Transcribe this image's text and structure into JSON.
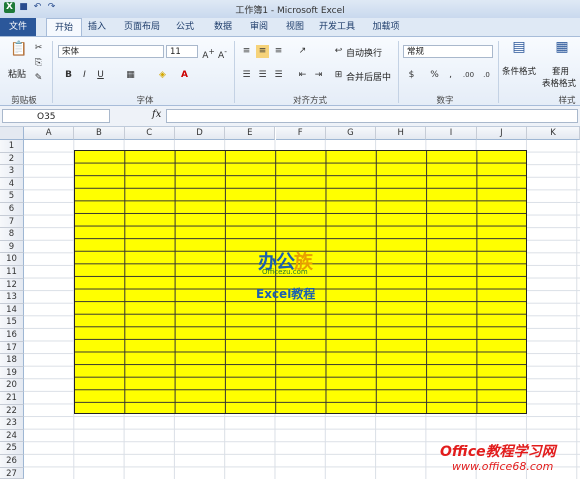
{
  "window": {
    "title": "工作簿1 - Microsoft Excel"
  },
  "tabs": [
    "文件",
    "开始",
    "插入",
    "页面布局",
    "公式",
    "数据",
    "审阅",
    "视图",
    "开发工具",
    "加载项"
  ],
  "ribbon": {
    "clipboard": {
      "paste": "粘贴",
      "group": "剪贴板"
    },
    "font": {
      "name": "宋体",
      "size": "11",
      "bold": "B",
      "italic": "I",
      "underline": "U",
      "group": "字体"
    },
    "alignment": {
      "wrap": "自动换行",
      "merge": "合并后居中",
      "group": "对齐方式"
    },
    "number": {
      "format": "常规",
      "percent": "%",
      "comma": ",",
      "group": "数字"
    },
    "styles": {
      "cond": "条件格式",
      "table1": "套用",
      "table2": "表格格式",
      "group": "样式"
    }
  },
  "formula_bar": {
    "name_box": "O35",
    "fx": "fx",
    "value": ""
  },
  "columns": [
    "A",
    "B",
    "C",
    "D",
    "E",
    "F",
    "G",
    "H",
    "I",
    "J",
    "K"
  ],
  "rows": [
    "1",
    "2",
    "3",
    "4",
    "5",
    "6",
    "7",
    "8",
    "9",
    "10",
    "11",
    "12",
    "13",
    "14",
    "15",
    "16",
    "17",
    "18",
    "19",
    "20",
    "21",
    "22",
    "23",
    "24",
    "25",
    "26",
    "27"
  ],
  "highlight": {
    "range": "B2:J22",
    "fill": "#ffff00",
    "border": "#000000"
  },
  "center_logo": {
    "part1": "办公",
    "part2": "族",
    "site": "Officezu.com",
    "sub": "Excel教程"
  },
  "watermark": {
    "line1": "Office教程学习网",
    "line2": "www.office68.com"
  }
}
